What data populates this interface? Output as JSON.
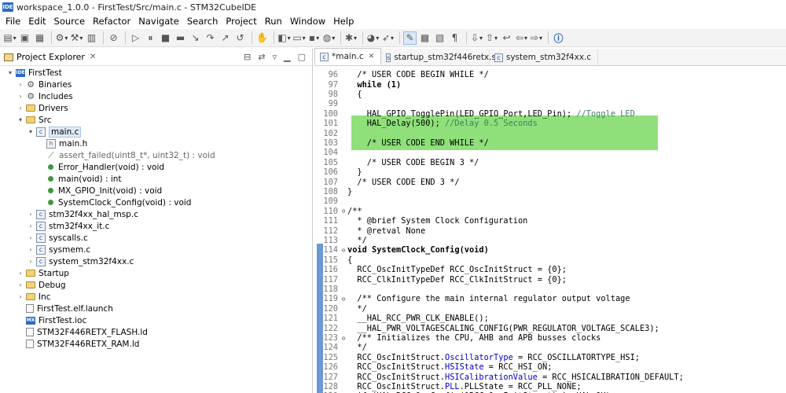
{
  "window": {
    "title": "workspace_1.0.0 - FirstTest/Src/main.c - STM32CubeIDE",
    "app_badge": "IDE"
  },
  "menu": [
    "File",
    "Edit",
    "Source",
    "Refactor",
    "Navigate",
    "Search",
    "Project",
    "Run",
    "Window",
    "Help"
  ],
  "explorer": {
    "title": "Project Explorer",
    "close": "✕",
    "tree": [
      {
        "depth": 0,
        "arrow": "▾",
        "icon": "project",
        "badge": "IDE",
        "label": "FirstTest"
      },
      {
        "depth": 1,
        "arrow": "›",
        "icon": "gear",
        "label": "Binaries"
      },
      {
        "depth": 1,
        "arrow": "›",
        "icon": "gear",
        "label": "Includes"
      },
      {
        "depth": 1,
        "arrow": "›",
        "icon": "folder",
        "label": "Drivers"
      },
      {
        "depth": 1,
        "arrow": "▾",
        "icon": "folder",
        "label": "Src"
      },
      {
        "depth": 2,
        "arrow": "▾",
        "icon": "cfile",
        "badge": "c",
        "label": "main.c",
        "selected": true
      },
      {
        "depth": 3,
        "arrow": "",
        "icon": "hfile",
        "badge": "h",
        "label": "main.h"
      },
      {
        "depth": 3,
        "arrow": "",
        "icon": "link",
        "label": "assert_failed(uint8_t*, uint32_t) : void",
        "muted": true
      },
      {
        "depth": 3,
        "arrow": "",
        "icon": "dot",
        "label": "Error_Handler(void) : void"
      },
      {
        "depth": 3,
        "arrow": "",
        "icon": "dot",
        "label": "main(void) : int"
      },
      {
        "depth": 3,
        "arrow": "",
        "icon": "dot",
        "label": "MX_GPIO_Init(void) : void"
      },
      {
        "depth": 3,
        "arrow": "",
        "icon": "dot",
        "label": "SystemClock_Config(void) : void"
      },
      {
        "depth": 2,
        "arrow": "›",
        "icon": "cfile",
        "badge": "c",
        "label": "stm32f4xx_hal_msp.c"
      },
      {
        "depth": 2,
        "arrow": "›",
        "icon": "cfile",
        "badge": "c",
        "label": "stm32f4xx_it.c"
      },
      {
        "depth": 2,
        "arrow": "›",
        "icon": "cfile",
        "badge": "c",
        "label": "syscalls.c"
      },
      {
        "depth": 2,
        "arrow": "›",
        "icon": "cfile",
        "badge": "c",
        "label": "sysmem.c"
      },
      {
        "depth": 2,
        "arrow": "›",
        "icon": "cfile",
        "badge": "c",
        "label": "system_stm32f4xx.c"
      },
      {
        "depth": 1,
        "arrow": "›",
        "icon": "folder",
        "label": "Startup"
      },
      {
        "depth": 1,
        "arrow": "›",
        "icon": "folder",
        "label": "Debug"
      },
      {
        "depth": 1,
        "arrow": "›",
        "icon": "folder",
        "label": "Inc"
      },
      {
        "depth": 1,
        "arrow": "",
        "icon": "file",
        "label": "FirstTest.elf.launch"
      },
      {
        "depth": 1,
        "arrow": "",
        "icon": "mx",
        "badge": "MX",
        "label": "FirstTest.ioc"
      },
      {
        "depth": 1,
        "arrow": "",
        "icon": "file",
        "label": "STM32F446RETX_FLASH.ld"
      },
      {
        "depth": 1,
        "arrow": "",
        "icon": "file",
        "label": "STM32F446RETX_RAM.ld"
      }
    ]
  },
  "tabs": [
    {
      "label": "*main.c",
      "close": "✕",
      "badge": "c",
      "active": true
    },
    {
      "label": "startup_stm32f446retx.s",
      "badge": "s",
      "active": false
    },
    {
      "label": "system_stm32f4xx.c",
      "badge": "c",
      "active": false
    }
  ],
  "code": [
    {
      "n": "96",
      "fold": "",
      "t": "  /* USER CODE BEGIN WHILE */",
      "cls": "cm"
    },
    {
      "n": "97",
      "fold": "",
      "t": "  while (1)",
      "cls": "kwline"
    },
    {
      "n": "98",
      "fold": "",
      "t": "  {",
      "cls": ""
    },
    {
      "n": "99",
      "fold": "",
      "t": "",
      "cls": ""
    },
    {
      "n": "100",
      "fold": "",
      "t": "    HAL_GPIO_TogglePin(LED_GPIO_Port,LED_Pin); ",
      "tail": "//Toggle LED",
      "cls": "split"
    },
    {
      "n": "101",
      "fold": "",
      "t": "    HAL_Delay(500); ",
      "tail": "//Delay 0.5 Seconds",
      "cls": "split"
    },
    {
      "n": "102",
      "fold": "",
      "t": "",
      "cls": ""
    },
    {
      "n": "103",
      "fold": "",
      "t": "    /* USER CODE END WHILE */",
      "cls": "cm"
    },
    {
      "n": "104",
      "fold": "",
      "t": "",
      "cls": ""
    },
    {
      "n": "105",
      "fold": "",
      "t": "    /* USER CODE BEGIN 3 */",
      "cls": "cm"
    },
    {
      "n": "106",
      "fold": "",
      "t": "  }",
      "cls": ""
    },
    {
      "n": "107",
      "fold": "",
      "t": "  /* USER CODE END 3 */",
      "cls": "cm"
    },
    {
      "n": "108",
      "fold": "",
      "t": "}",
      "cls": ""
    },
    {
      "n": "109",
      "fold": "",
      "t": "",
      "cls": ""
    },
    {
      "n": "110",
      "fold": "⊖",
      "t": "/**",
      "cls": "cm"
    },
    {
      "n": "111",
      "fold": "",
      "t": "  * @brief System Clock Configuration",
      "cls": "cm"
    },
    {
      "n": "112",
      "fold": "",
      "t": "  * @retval None",
      "cls": "cm"
    },
    {
      "n": "113",
      "fold": "",
      "t": "  */",
      "cls": "cm"
    },
    {
      "n": "114",
      "fold": "⊖",
      "t": "void SystemClock_Config(void)",
      "cls": "fn"
    },
    {
      "n": "115",
      "fold": "",
      "t": "{",
      "cls": ""
    },
    {
      "n": "116",
      "fold": "",
      "t": "  RCC_OscInitTypeDef RCC_OscInitStruct = {0};",
      "cls": ""
    },
    {
      "n": "117",
      "fold": "",
      "t": "  RCC_ClkInitTypeDef RCC_ClkInitStruct = {0};",
      "cls": ""
    },
    {
      "n": "118",
      "fold": "",
      "t": "",
      "cls": ""
    },
    {
      "n": "119",
      "fold": "⊖",
      "t": "  /** Configure the main internal regulator output voltage",
      "cls": "cm"
    },
    {
      "n": "120",
      "fold": "",
      "t": "  */",
      "cls": "cm"
    },
    {
      "n": "121",
      "fold": "",
      "t": "  __HAL_RCC_PWR_CLK_ENABLE();",
      "cls": ""
    },
    {
      "n": "122",
      "fold": "",
      "t": "  __HAL_PWR_VOLTAGESCALING_CONFIG(PWR_REGULATOR_VOLTAGE_SCALE3);",
      "cls": ""
    },
    {
      "n": "123",
      "fold": "⊖",
      "t": "  /** Initializes the CPU, AHB and APB busses clocks",
      "cls": "cm"
    },
    {
      "n": "124",
      "fold": "",
      "t": "  */",
      "cls": "cm"
    },
    {
      "n": "125",
      "fold": "",
      "t": "  RCC_OscInitStruct.",
      "field": "OscillatorType",
      "rest": " = RCC_OSCILLATORTYPE_HSI;",
      "cls": "fieldline"
    },
    {
      "n": "126",
      "fold": "",
      "t": "  RCC_OscInitStruct.",
      "field": "HSIState",
      "rest": " = RCC_HSI_ON;",
      "cls": "fieldline"
    },
    {
      "n": "127",
      "fold": "",
      "t": "  RCC_OscInitStruct.",
      "field": "HSICalibrationValue",
      "rest": " = RCC_HSICALIBRATION_DEFAULT;",
      "cls": "fieldline"
    },
    {
      "n": "128",
      "fold": "",
      "t": "  RCC_OscInitStruct.",
      "field": "PLL",
      "rest": ".PLLState = RCC_PLL_NONE;",
      "cls": "fieldline"
    },
    {
      "n": "129",
      "fold": "",
      "t": "  if (HAL_RCC_OscConfig(&RCC_OscInitStruct) != HAL_OK)",
      "cls": ""
    }
  ]
}
